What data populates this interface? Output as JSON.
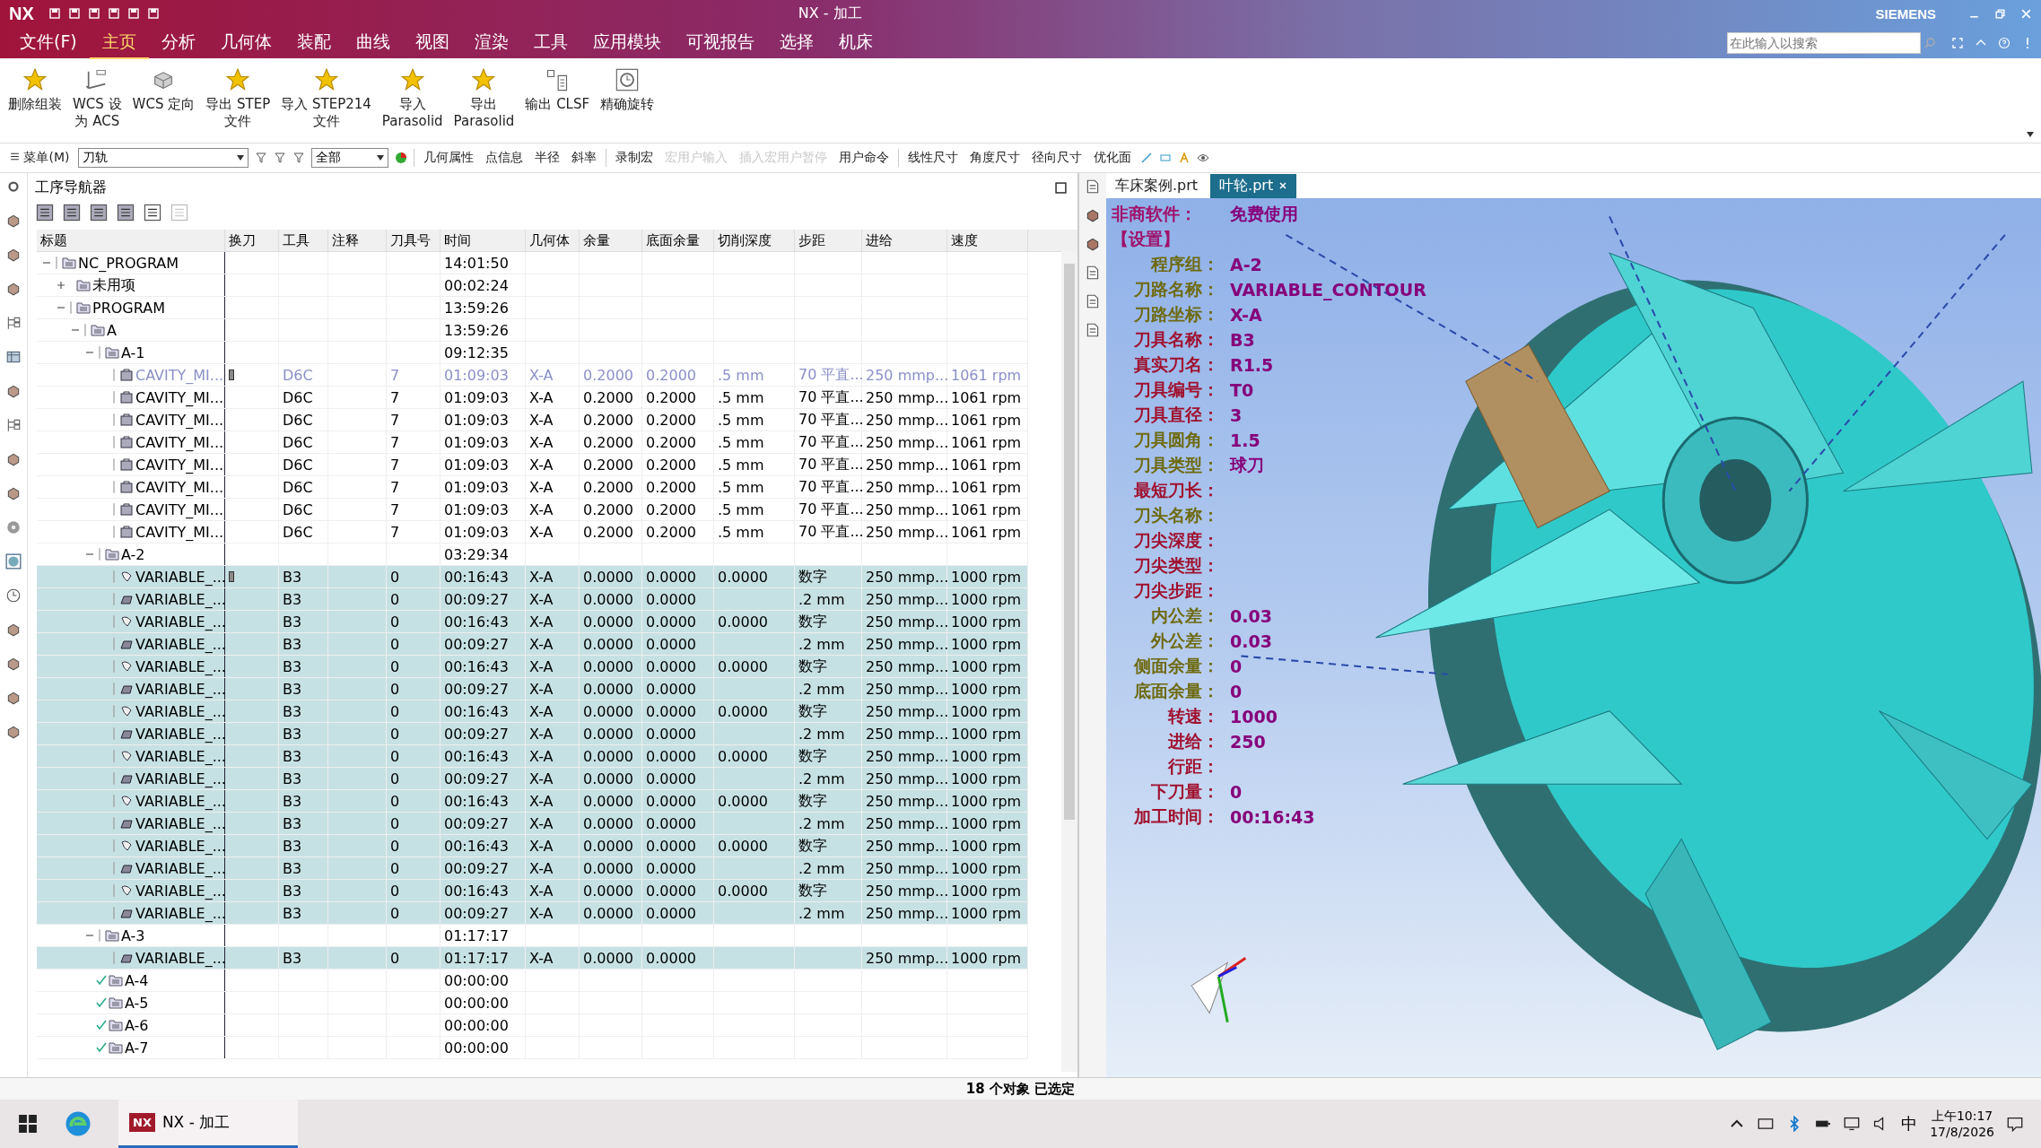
{
  "window": {
    "logo": "NX",
    "title": "NX - 加工",
    "brand": "SIEMENS",
    "search": {
      "placeholder": "在此输入以搜索"
    }
  },
  "menu_tabs": [
    {
      "label": "文件(F)",
      "selected": false
    },
    {
      "label": "主页",
      "selected": true
    },
    {
      "label": "分析",
      "selected": false
    },
    {
      "label": "几何体",
      "selected": false
    },
    {
      "label": "装配",
      "selected": false
    },
    {
      "label": "曲线",
      "selected": false
    },
    {
      "label": "视图",
      "selected": false
    },
    {
      "label": "渲染",
      "selected": false
    },
    {
      "label": "工具",
      "selected": false
    },
    {
      "label": "应用模块",
      "selected": false
    },
    {
      "label": "可视报告",
      "selected": false
    },
    {
      "label": "选择",
      "selected": false
    },
    {
      "label": "机床",
      "selected": false
    }
  ],
  "ribbon": [
    {
      "kind": "star",
      "lines": [
        "删除组装"
      ]
    },
    {
      "kind": "wcs",
      "lines": [
        "WCS 设",
        "为 ACS"
      ]
    },
    {
      "kind": "orient",
      "lines": [
        "WCS 定向"
      ]
    },
    {
      "kind": "star",
      "lines": [
        "导出 STEP",
        "文件"
      ]
    },
    {
      "kind": "star",
      "lines": [
        "导入 STEP214",
        "文件"
      ]
    },
    {
      "kind": "star",
      "lines": [
        "导入",
        "Parasolid"
      ]
    },
    {
      "kind": "star",
      "lines": [
        "导出",
        "Parasolid"
      ]
    },
    {
      "kind": "clsf",
      "lines": [
        "输出 CLSF"
      ]
    },
    {
      "kind": "rotate",
      "lines": [
        "精确旋转"
      ]
    }
  ],
  "toolbar": {
    "menu": "菜单(M)",
    "filter": "刀轨",
    "scope": "全部",
    "groups": [
      [
        {
          "label": "几何属性",
          "disabled": false
        },
        {
          "label": "点信息",
          "disabled": false
        },
        {
          "label": "半径",
          "disabled": false
        },
        {
          "label": "斜率",
          "disabled": false
        }
      ],
      [
        {
          "label": "录制宏",
          "disabled": false
        },
        {
          "label": "宏用户输入",
          "disabled": true
        },
        {
          "label": "插入宏用户暂停",
          "disabled": true
        },
        {
          "label": "用户命令",
          "disabled": false
        }
      ],
      [
        {
          "label": "线性尺寸",
          "disabled": false
        },
        {
          "label": "角度尺寸",
          "disabled": false
        },
        {
          "label": "径向尺寸",
          "disabled": false
        },
        {
          "label": "优化面",
          "disabled": false
        }
      ]
    ]
  },
  "navigator": {
    "title": "工序导航器",
    "columns": [
      "标题",
      "换刀",
      "工具",
      "注释",
      "刀具号",
      "时间",
      "几何体",
      "余量",
      "底面余量",
      "切削深度",
      "步距",
      "进给",
      "速度"
    ],
    "rows": [
      {
        "kind": "group",
        "title": "NC_PROGRAM",
        "regenerate": true,
        "complete": false,
        "expanded": true,
        "selected": false,
        "time": "14:01:50",
        "children": [
          {
            "kind": "group",
            "title": "未用项",
            "regenerate": false,
            "complete": false,
            "expanded": false,
            "selected": false,
            "time": "00:02:24"
          },
          {
            "kind": "group",
            "title": "PROGRAM",
            "regenerate": true,
            "complete": false,
            "expanded": true,
            "selected": false,
            "time": "13:59:26",
            "children": [
              {
                "kind": "group",
                "title": "A",
                "regenerate": true,
                "complete": false,
                "expanded": true,
                "selected": false,
                "time": "13:59:26",
                "children": [
                  {
                    "kind": "group",
                    "title": "A-1",
                    "regenerate": true,
                    "complete": false,
                    "expanded": true,
                    "selected": false,
                    "time": "09:12:35",
                    "children": [
                      {
                        "kind": "cavity",
                        "title": "CAVITY_MI...",
                        "regenerate": true,
                        "selected": false,
                        "dimmed": true,
                        "tool_change": true,
                        "tool": "D6C",
                        "tool_number": "7",
                        "time": "01:09:03",
                        "geometry": "X-A",
                        "stock": "0.2000",
                        "floor_stock": "0.2000",
                        "cut_depth": ".5 mm",
                        "stepover": "70 平直...",
                        "feed": "250 mmp...",
                        "speed": "1061 rpm"
                      },
                      {
                        "kind": "cavity",
                        "title": "CAVITY_MI...",
                        "regenerate": true,
                        "selected": false,
                        "dimmed": false,
                        "tool_change": false,
                        "tool": "D6C",
                        "tool_number": "7",
                        "time": "01:09:03",
                        "geometry": "X-A",
                        "stock": "0.2000",
                        "floor_stock": "0.2000",
                        "cut_depth": ".5 mm",
                        "stepover": "70 平直...",
                        "feed": "250 mmp...",
                        "speed": "1061 rpm"
                      },
                      {
                        "kind": "cavity",
                        "title": "CAVITY_MI...",
                        "regenerate": true,
                        "selected": false,
                        "dimmed": false,
                        "tool_change": false,
                        "tool": "D6C",
                        "tool_number": "7",
                        "time": "01:09:03",
                        "geometry": "X-A",
                        "stock": "0.2000",
                        "floor_stock": "0.2000",
                        "cut_depth": ".5 mm",
                        "stepover": "70 平直...",
                        "feed": "250 mmp...",
                        "speed": "1061 rpm"
                      },
                      {
                        "kind": "cavity",
                        "title": "CAVITY_MI...",
                        "regenerate": true,
                        "selected": false,
                        "dimmed": false,
                        "tool_change": false,
                        "tool": "D6C",
                        "tool_number": "7",
                        "time": "01:09:03",
                        "geometry": "X-A",
                        "stock": "0.2000",
                        "floor_stock": "0.2000",
                        "cut_depth": ".5 mm",
                        "stepover": "70 平直...",
                        "feed": "250 mmp...",
                        "speed": "1061 rpm"
                      },
                      {
                        "kind": "cavity",
                        "title": "CAVITY_MI...",
                        "regenerate": true,
                        "selected": false,
                        "dimmed": false,
                        "tool_change": false,
                        "tool": "D6C",
                        "tool_number": "7",
                        "time": "01:09:03",
                        "geometry": "X-A",
                        "stock": "0.2000",
                        "floor_stock": "0.2000",
                        "cut_depth": ".5 mm",
                        "stepover": "70 平直...",
                        "feed": "250 mmp...",
                        "speed": "1061 rpm"
                      },
                      {
                        "kind": "cavity",
                        "title": "CAVITY_MI...",
                        "regenerate": true,
                        "selected": false,
                        "dimmed": false,
                        "tool_change": false,
                        "tool": "D6C",
                        "tool_number": "7",
                        "time": "01:09:03",
                        "geometry": "X-A",
                        "stock": "0.2000",
                        "floor_stock": "0.2000",
                        "cut_depth": ".5 mm",
                        "stepover": "70 平直...",
                        "feed": "250 mmp...",
                        "speed": "1061 rpm"
                      },
                      {
                        "kind": "cavity",
                        "title": "CAVITY_MI...",
                        "regenerate": true,
                        "selected": false,
                        "dimmed": false,
                        "tool_change": false,
                        "tool": "D6C",
                        "tool_number": "7",
                        "time": "01:09:03",
                        "geometry": "X-A",
                        "stock": "0.2000",
                        "floor_stock": "0.2000",
                        "cut_depth": ".5 mm",
                        "stepover": "70 平直...",
                        "feed": "250 mmp...",
                        "speed": "1061 rpm"
                      },
                      {
                        "kind": "cavity",
                        "title": "CAVITY_MI...",
                        "regenerate": true,
                        "selected": false,
                        "dimmed": false,
                        "tool_change": false,
                        "tool": "D6C",
                        "tool_number": "7",
                        "time": "01:09:03",
                        "geometry": "X-A",
                        "stock": "0.2000",
                        "floor_stock": "0.2000",
                        "cut_depth": ".5 mm",
                        "stepover": "70 平直...",
                        "feed": "250 mmp...",
                        "speed": "1061 rpm"
                      }
                    ]
                  },
                  {
                    "kind": "group",
                    "title": "A-2",
                    "regenerate": true,
                    "complete": false,
                    "expanded": true,
                    "selected": false,
                    "time": "03:29:34",
                    "children": [
                      {
                        "kind": "contour",
                        "title": "VARIABLE_...",
                        "regenerate": true,
                        "selected": true,
                        "dimmed": false,
                        "tool_change": true,
                        "tool": "B3",
                        "tool_number": "0",
                        "time": "00:16:43",
                        "geometry": "X-A",
                        "stock": "0.0000",
                        "floor_stock": "0.0000",
                        "cut_depth": "0.0000",
                        "stepover": "数字",
                        "feed": "250 mmp...",
                        "speed": "1000 rpm"
                      },
                      {
                        "kind": "surface",
                        "title": "VARIABLE_...",
                        "regenerate": true,
                        "selected": true,
                        "dimmed": false,
                        "tool_change": false,
                        "tool": "B3",
                        "tool_number": "0",
                        "time": "00:09:27",
                        "geometry": "X-A",
                        "stock": "0.0000",
                        "floor_stock": "0.0000",
                        "stepover": ".2 mm",
                        "feed": "250 mmp...",
                        "speed": "1000 rpm"
                      },
                      {
                        "kind": "contour",
                        "title": "VARIABLE_...",
                        "regenerate": true,
                        "selected": true,
                        "dimmed": false,
                        "tool_change": false,
                        "tool": "B3",
                        "tool_number": "0",
                        "time": "00:16:43",
                        "geometry": "X-A",
                        "stock": "0.0000",
                        "floor_stock": "0.0000",
                        "cut_depth": "0.0000",
                        "stepover": "数字",
                        "feed": "250 mmp...",
                        "speed": "1000 rpm"
                      },
                      {
                        "kind": "surface",
                        "title": "VARIABLE_...",
                        "regenerate": true,
                        "selected": true,
                        "dimmed": false,
                        "tool_change": false,
                        "tool": "B3",
                        "tool_number": "0",
                        "time": "00:09:27",
                        "geometry": "X-A",
                        "stock": "0.0000",
                        "floor_stock": "0.0000",
                        "stepover": ".2 mm",
                        "feed": "250 mmp...",
                        "speed": "1000 rpm"
                      },
                      {
                        "kind": "contour",
                        "title": "VARIABLE_...",
                        "regenerate": true,
                        "selected": true,
                        "dimmed": false,
                        "tool_change": false,
                        "tool": "B3",
                        "tool_number": "0",
                        "time": "00:16:43",
                        "geometry": "X-A",
                        "stock": "0.0000",
                        "floor_stock": "0.0000",
                        "cut_depth": "0.0000",
                        "stepover": "数字",
                        "feed": "250 mmp...",
                        "speed": "1000 rpm"
                      },
                      {
                        "kind": "surface",
                        "title": "VARIABLE_...",
                        "regenerate": true,
                        "selected": true,
                        "dimmed": false,
                        "tool_change": false,
                        "tool": "B3",
                        "tool_number": "0",
                        "time": "00:09:27",
                        "geometry": "X-A",
                        "stock": "0.0000",
                        "floor_stock": "0.0000",
                        "stepover": ".2 mm",
                        "feed": "250 mmp...",
                        "speed": "1000 rpm"
                      },
                      {
                        "kind": "contour",
                        "title": "VARIABLE_...",
                        "regenerate": true,
                        "selected": true,
                        "dimmed": false,
                        "tool_change": false,
                        "tool": "B3",
                        "tool_number": "0",
                        "time": "00:16:43",
                        "geometry": "X-A",
                        "stock": "0.0000",
                        "floor_stock": "0.0000",
                        "cut_depth": "0.0000",
                        "stepover": "数字",
                        "feed": "250 mmp...",
                        "speed": "1000 rpm"
                      },
                      {
                        "kind": "surface",
                        "title": "VARIABLE_...",
                        "regenerate": true,
                        "selected": true,
                        "dimmed": false,
                        "tool_change": false,
                        "tool": "B3",
                        "tool_number": "0",
                        "time": "00:09:27",
                        "geometry": "X-A",
                        "stock": "0.0000",
                        "floor_stock": "0.0000",
                        "stepover": ".2 mm",
                        "feed": "250 mmp...",
                        "speed": "1000 rpm"
                      },
                      {
                        "kind": "contour",
                        "title": "VARIABLE_...",
                        "regenerate": true,
                        "selected": true,
                        "dimmed": false,
                        "tool_change": false,
                        "tool": "B3",
                        "tool_number": "0",
                        "time": "00:16:43",
                        "geometry": "X-A",
                        "stock": "0.0000",
                        "floor_stock": "0.0000",
                        "cut_depth": "0.0000",
                        "stepover": "数字",
                        "feed": "250 mmp...",
                        "speed": "1000 rpm"
                      },
                      {
                        "kind": "surface",
                        "title": "VARIABLE_...",
                        "regenerate": true,
                        "selected": true,
                        "dimmed": false,
                        "tool_change": false,
                        "tool": "B3",
                        "tool_number": "0",
                        "time": "00:09:27",
                        "geometry": "X-A",
                        "stock": "0.0000",
                        "floor_stock": "0.0000",
                        "stepover": ".2 mm",
                        "feed": "250 mmp...",
                        "speed": "1000 rpm"
                      },
                      {
                        "kind": "contour",
                        "title": "VARIABLE_...",
                        "regenerate": true,
                        "selected": true,
                        "dimmed": false,
                        "tool_change": false,
                        "tool": "B3",
                        "tool_number": "0",
                        "time": "00:16:43",
                        "geometry": "X-A",
                        "stock": "0.0000",
                        "floor_stock": "0.0000",
                        "cut_depth": "0.0000",
                        "stepover": "数字",
                        "feed": "250 mmp...",
                        "speed": "1000 rpm"
                      },
                      {
                        "kind": "surface",
                        "title": "VARIABLE_...",
                        "regenerate": true,
                        "selected": true,
                        "dimmed": false,
                        "tool_change": false,
                        "tool": "B3",
                        "tool_number": "0",
                        "time": "00:09:27",
                        "geometry": "X-A",
                        "stock": "0.0000",
                        "floor_stock": "0.0000",
                        "stepover": ".2 mm",
                        "feed": "250 mmp...",
                        "speed": "1000 rpm"
                      },
                      {
                        "kind": "contour",
                        "title": "VARIABLE_...",
                        "regenerate": true,
                        "selected": true,
                        "dimmed": false,
                        "tool_change": false,
                        "tool": "B3",
                        "tool_number": "0",
                        "time": "00:16:43",
                        "geometry": "X-A",
                        "stock": "0.0000",
                        "floor_stock": "0.0000",
                        "cut_depth": "0.0000",
                        "stepover": "数字",
                        "feed": "250 mmp...",
                        "speed": "1000 rpm"
                      },
                      {
                        "kind": "surface",
                        "title": "VARIABLE_...",
                        "regenerate": true,
                        "selected": true,
                        "dimmed": false,
                        "tool_change": false,
                        "tool": "B3",
                        "tool_number": "0",
                        "time": "00:09:27",
                        "geometry": "X-A",
                        "stock": "0.0000",
                        "floor_stock": "0.0000",
                        "stepover": ".2 mm",
                        "feed": "250 mmp...",
                        "speed": "1000 rpm"
                      },
                      {
                        "kind": "contour",
                        "title": "VARIABLE_...",
                        "regenerate": true,
                        "selected": true,
                        "dimmed": false,
                        "tool_change": false,
                        "tool": "B3",
                        "tool_number": "0",
                        "time": "00:16:43",
                        "geometry": "X-A",
                        "stock": "0.0000",
                        "floor_stock": "0.0000",
                        "cut_depth": "0.0000",
                        "stepover": "数字",
                        "feed": "250 mmp...",
                        "speed": "1000 rpm"
                      },
                      {
                        "kind": "surface",
                        "title": "VARIABLE_...",
                        "regenerate": true,
                        "selected": true,
                        "dimmed": false,
                        "tool_change": false,
                        "tool": "B3",
                        "tool_number": "0",
                        "time": "00:09:27",
                        "geometry": "X-A",
                        "stock": "0.0000",
                        "floor_stock": "0.0000",
                        "stepover": ".2 mm",
                        "feed": "250 mmp...",
                        "speed": "1000 rpm"
                      }
                    ]
                  },
                  {
                    "kind": "group",
                    "title": "A-3",
                    "regenerate": true,
                    "complete": false,
                    "expanded": true,
                    "selected": false,
                    "time": "01:17:17",
                    "children": [
                      {
                        "kind": "surface",
                        "title": "VARIABLE_...",
                        "regenerate": true,
                        "selected": true,
                        "dimmed": false,
                        "tool_change": false,
                        "tool": "B3",
                        "tool_number": "0",
                        "time": "01:17:17",
                        "geometry": "X-A",
                        "stock": "0.0000",
                        "floor_stock": "0.0000",
                        "feed": "250 mmp...",
                        "speed": "1000 rpm"
                      }
                    ]
                  },
                  {
                    "kind": "group",
                    "title": "A-4",
                    "regenerate": false,
                    "complete": true,
                    "selected": false,
                    "time": "00:00:00"
                  },
                  {
                    "kind": "group",
                    "title": "A-5",
                    "regenerate": false,
                    "complete": true,
                    "selected": false,
                    "time": "00:00:00"
                  },
                  {
                    "kind": "group",
                    "title": "A-6",
                    "regenerate": false,
                    "complete": true,
                    "selected": false,
                    "time": "00:00:00"
                  },
                  {
                    "kind": "group",
                    "title": "A-7",
                    "regenerate": false,
                    "complete": true,
                    "selected": false,
                    "time": "00:00:00"
                  }
                ]
              }
            ]
          }
        ]
      }
    ]
  },
  "graphics": {
    "tabs": [
      {
        "label": "车床案例.prt",
        "selected": false
      },
      {
        "label": "叶轮.prt",
        "selected": true
      }
    ],
    "info_header": [
      {
        "label": "非商软件：",
        "value": "免费使用"
      },
      {
        "label": "【设置】"
      }
    ],
    "info": [
      {
        "label": "程序组：",
        "value": "A-2",
        "color": "#6e6a10"
      },
      {
        "label": "刀路名称：",
        "value": "VARIABLE_CONTOUR",
        "color": "#6e6a10"
      },
      {
        "label": "刀路坐标：",
        "value": "X-A",
        "color": "#6e6a10"
      },
      {
        "label": "刀具名称：",
        "value": "B3",
        "color": "#a0102e"
      },
      {
        "label": "真实刀名：",
        "value": "R1.5",
        "color": "#a0102e"
      },
      {
        "label": "刀具编号：",
        "value": "T0",
        "color": "#a0102e"
      },
      {
        "label": "刀具直径：",
        "value": "3",
        "color": "#a0102e"
      },
      {
        "label": "刀具圆角：",
        "value": "1.5",
        "color": "#6e6a10"
      },
      {
        "label": "刀具类型：",
        "value": "球刀",
        "color": "#6e6a10"
      },
      {
        "label": "最短刀长：",
        "color": "#a0102e"
      },
      {
        "label": "刀头名称：",
        "color": "#6e6a10"
      },
      {
        "label": "刀尖深度：",
        "color": "#a0102e"
      },
      {
        "label": "刀尖类型：",
        "color": "#a0102e"
      },
      {
        "label": "刀尖步距：",
        "color": "#a0102e"
      },
      {
        "label": "内公差：",
        "value": "0.03",
        "color": "#6e6a10"
      },
      {
        "label": "外公差：",
        "value": "0.03",
        "color": "#6e6a10"
      },
      {
        "label": "侧面余量：",
        "value": "0",
        "color": "#6e6a10"
      },
      {
        "label": "底面余量：",
        "value": "0",
        "color": "#6e6a10"
      },
      {
        "label": "转速：",
        "value": "1000",
        "color": "#a0102e"
      },
      {
        "label": "进给：",
        "value": "250",
        "color": "#a0102e"
      },
      {
        "label": "行距：",
        "color": "#a0102e"
      },
      {
        "label": "下刀量：",
        "value": "0",
        "color": "#a0102e"
      },
      {
        "label": "加工时间：",
        "value": "00:16:43",
        "color": "#a0102e"
      }
    ]
  },
  "status_bar": "18 个对象 已选定",
  "taskbar": {
    "app": {
      "icon_text": "NX",
      "label": "NX - 加工"
    },
    "ime": "中",
    "time": "上午10:17",
    "date": "17/8/2026"
  }
}
